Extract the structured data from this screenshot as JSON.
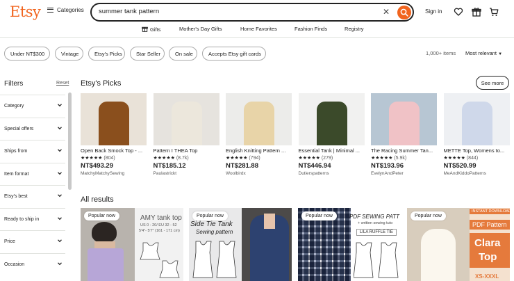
{
  "header": {
    "logo": "Etsy",
    "categories_label": "Categories",
    "search_value": "summer tank pattern",
    "signin_label": "Sign in"
  },
  "nav": [
    "Gifts",
    "Mother's Day Gifts",
    "Home Favorites",
    "Fashion Finds",
    "Registry"
  ],
  "chips": [
    "Under NT$300",
    "Vintage",
    "Etsy's Picks",
    "Star Seller",
    "On sale",
    "Accepts Etsy gift cards"
  ],
  "results_meta": {
    "count": "1,000+ items",
    "sort": "Most relevant"
  },
  "sidebar": {
    "title": "Filters",
    "reset": "Reset",
    "filters": [
      "Category",
      "Special offers",
      "Ships from",
      "Item format",
      "Etsy's best",
      "Ready to ship in",
      "Price",
      "Occasion"
    ]
  },
  "picks": {
    "title": "Etsy's Picks",
    "see_more": "See more",
    "items": [
      {
        "title": "Open Back Smock Top - ...",
        "reviews": "(804)",
        "price": "NT$493.29",
        "shop": "MatchyMatchySewing"
      },
      {
        "title": "Pattern I THEA Top",
        "reviews": "(8.7k)",
        "price": "NT$185.12",
        "shop": "Paulastrickt"
      },
      {
        "title": "English Knitting Pattern ...",
        "reviews": "(794)",
        "price": "NT$281.88",
        "shop": "Woolbirdx"
      },
      {
        "title": "Essential Tank | Minimal ...",
        "reviews": "(279)",
        "price": "NT$446.94",
        "shop": "Dutierspatterns"
      },
      {
        "title": "The Racing Summer Tan...",
        "reviews": "(5.9k)",
        "price": "NT$193.96",
        "shop": "EvelynAndPeter"
      },
      {
        "title": "METTE Top, Womens to...",
        "reviews": "(844)",
        "price": "NT$520.99",
        "shop": "MeAndKiddoPatterns"
      }
    ]
  },
  "results": {
    "title": "All results",
    "badge": "Popular now",
    "img_text": {
      "amy_title": "AMY tank top",
      "amy_sizes": "US 0 - 20/ EU 32 - 52",
      "amy_height": "5'4\"- 5'7\" (161 - 171 cm)",
      "side_tie_1": "Side Tie Tank",
      "side_tie_2": "Sewing pattern",
      "pdf_title": "PDF SEWING PATT",
      "pdf_sub": "+ written sewing tuto",
      "lila": "LILA RUFFLE TIE",
      "instant": "INSTANT DOWNLOAD",
      "pdf_pattern": "PDF Pattern",
      "clara1": "Clara",
      "clara2": "Top",
      "xs": "XS-XXXL"
    }
  },
  "colors": {
    "brand": "#f1641e",
    "stars": "#222222"
  }
}
